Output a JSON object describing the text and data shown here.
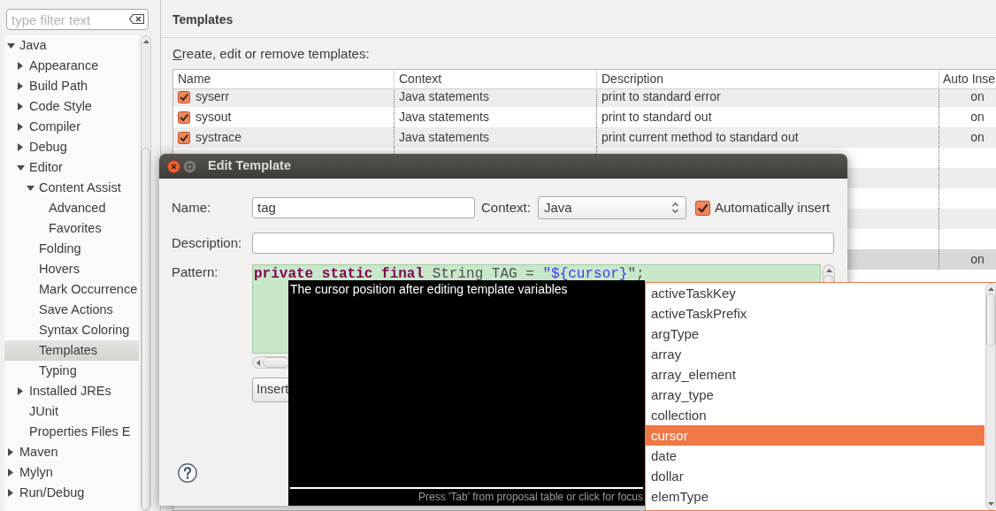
{
  "sidebar": {
    "filter": {
      "placeholder": "type filter text"
    },
    "tree": [
      {
        "label": "Java",
        "expanded": true,
        "selected": false,
        "children": [
          {
            "label": "Appearance",
            "expanded": false,
            "selected": false
          },
          {
            "label": "Build Path",
            "expanded": false,
            "selected": false
          },
          {
            "label": "Code Style",
            "expanded": false,
            "selected": false
          },
          {
            "label": "Compiler",
            "expanded": false,
            "selected": false
          },
          {
            "label": "Debug",
            "expanded": false,
            "selected": false
          },
          {
            "label": "Editor",
            "expanded": true,
            "selected": false,
            "children": [
              {
                "label": "Content Assist",
                "expanded": true,
                "selected": false,
                "children": [
                  {
                    "label": "Advanced",
                    "selected": false
                  },
                  {
                    "label": "Favorites",
                    "selected": false
                  }
                ]
              },
              {
                "label": "Folding",
                "selected": false
              },
              {
                "label": "Hovers",
                "selected": false
              },
              {
                "label": "Mark Occurrence",
                "selected": false
              },
              {
                "label": "Save Actions",
                "selected": false
              },
              {
                "label": "Syntax Coloring",
                "selected": false
              },
              {
                "label": "Templates",
                "selected": true
              },
              {
                "label": "Typing",
                "selected": false
              }
            ]
          },
          {
            "label": "Installed JREs",
            "expanded": false,
            "selected": false
          },
          {
            "label": "JUnit",
            "selected": false
          },
          {
            "label": "Properties Files E",
            "selected": false
          }
        ]
      },
      {
        "label": "Maven",
        "expanded": false,
        "selected": false
      },
      {
        "label": "Mylyn",
        "expanded": false,
        "selected": false
      },
      {
        "label": "Run/Debug",
        "expanded": false,
        "selected": false
      }
    ]
  },
  "main": {
    "title": "Templates",
    "instruction": "Create, edit or remove templates:",
    "table": {
      "columns": [
        "Name",
        "Context",
        "Description",
        "Auto Inse"
      ],
      "rows": [
        {
          "name": "syserr",
          "checked": true,
          "context": "Java statements",
          "description": "print to standard error",
          "auto_insert": "on",
          "selected": false
        },
        {
          "name": "sysout",
          "checked": true,
          "context": "Java statements",
          "description": "print to standard out",
          "auto_insert": "on",
          "selected": false
        },
        {
          "name": "systrace",
          "checked": true,
          "context": "Java statements",
          "description": "print current method to standard out",
          "auto_insert": "on",
          "selected": false
        },
        {
          "selected": false
        },
        {
          "selected": false
        },
        {
          "selected": false
        },
        {
          "selected": false
        },
        {
          "selected": false
        },
        {
          "auto_insert": "on",
          "selected": true
        }
      ]
    }
  },
  "dialog": {
    "title": "Edit Template",
    "name_label": "Name:",
    "name_value": "tag",
    "context_label": "Context:",
    "context_value": "Java",
    "auto_insert": {
      "label": "Automatically insert",
      "checked": true
    },
    "description_label": "Description:",
    "pattern_label": "Pattern:",
    "pattern": [
      {
        "text": "private static final",
        "kind": "keyword"
      },
      {
        "text": " String TAG = ",
        "kind": "plain"
      },
      {
        "text": "\"${cursor}",
        "kind": "string"
      },
      {
        "text": "\";",
        "kind": "plain"
      }
    ],
    "insert_button": "Insert"
  },
  "content_assist": {
    "info": "The cursor position after editing template variables",
    "footer": "Press 'Tab' from proposal table or click for focus",
    "proposals": [
      {
        "label": "activeTaskKey",
        "selected": false
      },
      {
        "label": "activeTaskPrefix",
        "selected": false
      },
      {
        "label": "argType",
        "selected": false
      },
      {
        "label": "array",
        "selected": false
      },
      {
        "label": "array_element",
        "selected": false
      },
      {
        "label": "array_type",
        "selected": false
      },
      {
        "label": "collection",
        "selected": false
      },
      {
        "label": "cursor",
        "selected": true
      },
      {
        "label": "date",
        "selected": false
      },
      {
        "label": "dollar",
        "selected": false
      },
      {
        "label": "elemType",
        "selected": false
      }
    ]
  }
}
